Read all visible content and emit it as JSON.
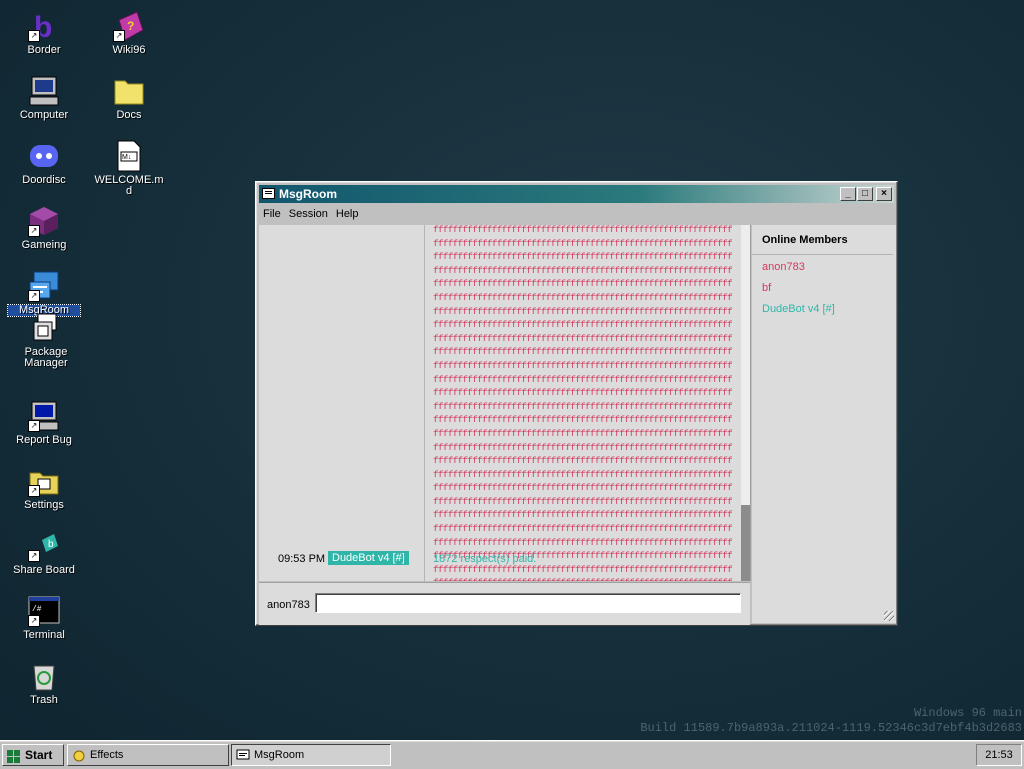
{
  "desktop": {
    "icons": [
      {
        "label": "Border"
      },
      {
        "label": "Wiki96"
      },
      {
        "label": "Computer"
      },
      {
        "label": "Docs"
      },
      {
        "label": "Doordisc"
      },
      {
        "label": "WELCOME.md"
      },
      {
        "label": "Gameing"
      },
      {
        "label": "MsgRoom"
      },
      {
        "label": "Package Manager"
      },
      {
        "label": "Report Bug"
      },
      {
        "label": "Settings"
      },
      {
        "label": "Share Board"
      },
      {
        "label": "Terminal"
      },
      {
        "label": "Trash"
      }
    ],
    "watermark": {
      "line1": "Windows 96 main",
      "line2": "Build 11589.7b9a893a.211024-1119.52346c3d7ebf4b3d2683"
    }
  },
  "window": {
    "title": "MsgRoom",
    "menu": [
      "File",
      "Session",
      "Help"
    ],
    "messages": {
      "spam_text": "ffffffffffffffffffffffffffffffffffffffffffffffffffffffffffffffffffffffffffffffffffffffffffffffffffffffffffffffffffffffffffffffffffffffffffffffffffffffffffffffffffffffffffffffffffffffffffffffffffffffffffffffffffffffffffffffffffffffffffffffffffffffffffffffffffffffffffffffffffffffffffffffffffffffffffffffffffffffffffffffffffffffffffffffffffffffffffffffffffffffffffffffffffffffffffffffffffffffffffffffffffffffffffffffffffffffffffffffffffffffffffffffffffffffffffffffffffffffffffffffffffffffffffffffffffffffffffffffffffffffffffffffffffffffffffffffffffffffffffffffffffffffffffffffffffffffffffffffffffffffffffffffffffffffffffffffffffffffffffffffffffffffffffffffffffffffffffffffffffffffffffffffffffffffffffffffffffffffffffffffffffffffffffffffffffffffffffffffffffffffffffffffffffffffffffffffffffffffffffffffffffffffffffffffffffffffffffffffffffffffffffffffffffffffffffffffffffffffffffffffffffffffffffffffffffffffffffffffffffffffffffffffffffffffffffffffffffffffffffffffffffffffffffffffffffffffffffffffffffffffffffffffffffffffffffffffffffffffffffffffffffffffffffffffffffffffffffffffffffffffffffffffffffffffffffffffffffffffffffffffffffffffffffffffffffffffffffffffffffffffffffffffffffffffffffffffffffffffffffffffffffffffffffffffffffffffffffffffffffffffffffffffffffffffffffffffffffffffffffffffffffffffffffffffffffffffffffffffffffffffffffffffffffffffffffffffffffffffffffffffffffffffffffffffffffffffffffffffffffffffffffffffffffffffffffffffffffffffffffffffffffffffffffffffffffffffffffffffffffffffffffffffffffffffffffffffffffffffffffffffffffffffffffffffffffffffffffffffffffffffffffffffffffffffffffffffffffffffffffffffffffffffffffffffffffffffffffffffffffffffffffffffffffffffffffffffffffffffffffffffffffffffffffffffffffffffffffffffffffffffffffffffffff",
      "last_time": "09:53 PM",
      "last_author": "DudeBot v4 [#]",
      "last_text": "1872 respect(s) paid."
    },
    "members_title": "Online Members",
    "members": [
      {
        "name": "anon783",
        "color": "#d23b5f"
      },
      {
        "name": "bf",
        "color": "#d23b5f"
      },
      {
        "name": "DudeBot v4 [#]",
        "color": "#2fb6a9"
      }
    ],
    "input": {
      "nick": "anon783",
      "value": ""
    }
  },
  "taskbar": {
    "start_label": "Start",
    "items": [
      {
        "label": "Effects"
      },
      {
        "label": "MsgRoom"
      }
    ],
    "clock": "21:53"
  }
}
